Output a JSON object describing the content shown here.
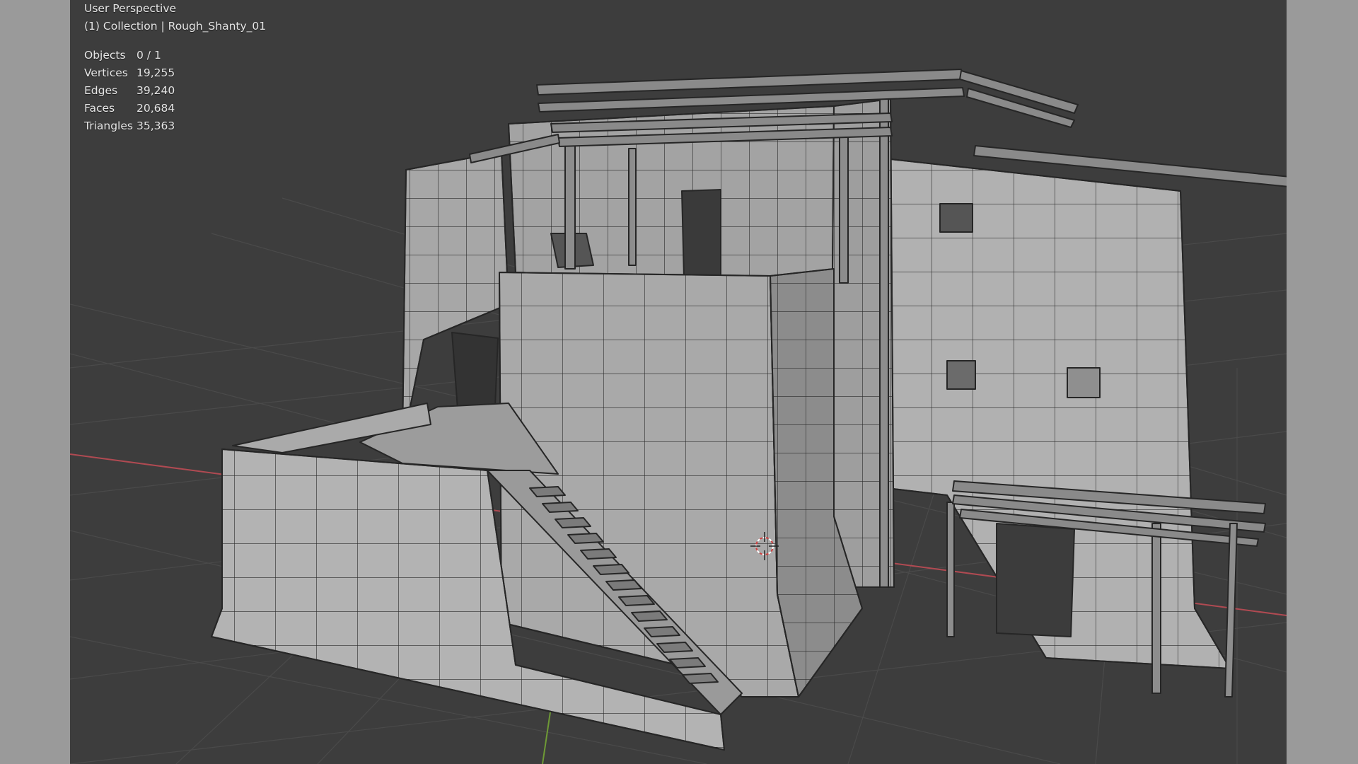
{
  "viewport": {
    "view_label": "User Perspective",
    "collection_label": "(1) Collection | Rough_Shanty_01"
  },
  "stats": [
    {
      "label": "Objects",
      "value": "0 / 1"
    },
    {
      "label": "Vertices",
      "value": "19,255"
    },
    {
      "label": "Edges",
      "value": "39,240"
    },
    {
      "label": "Faces",
      "value": "20,684"
    },
    {
      "label": "Triangles",
      "value": "35,363"
    }
  ],
  "colors": {
    "viewport_bg": "#3d3d3d",
    "grid": "#4a4a4a",
    "x_axis": "#b04a52",
    "y_axis": "#6e9a35",
    "mesh_fill": "#a7a7a7",
    "wire": "#262626"
  },
  "icons": {
    "cursor": "3d-cursor-icon"
  }
}
